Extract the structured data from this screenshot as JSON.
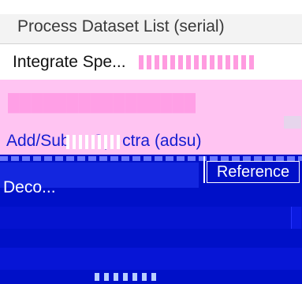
{
  "menu": {
    "title": "Process Dataset List (serial)",
    "items": [
      {
        "label": "Integrate Spe..."
      },
      {
        "label": "Add/Sub ... Spectra (adsu)"
      },
      {
        "label": "Deco..."
      }
    ]
  },
  "buttons": {
    "reference": "Reference"
  },
  "colors": {
    "menu_bg": "#f3f3f3",
    "pink_band": "#ffc4f2",
    "blue_panel": "#0010c8",
    "blue_text": "#141dd0"
  }
}
